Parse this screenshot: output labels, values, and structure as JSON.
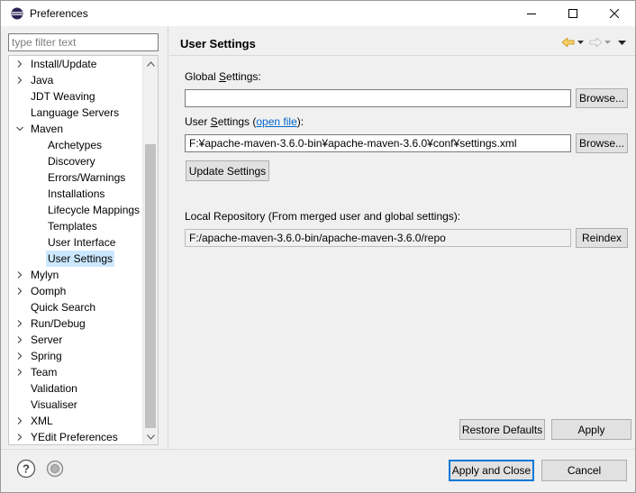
{
  "window": {
    "title": "Preferences",
    "minimize_icon": "minimize-icon",
    "maximize_icon": "maximize-icon",
    "close_icon": "close-icon"
  },
  "filter": {
    "placeholder": "type filter text",
    "value": ""
  },
  "tree": {
    "items": [
      {
        "label": "Install/Update",
        "level": 0,
        "twisty": "collapsed"
      },
      {
        "label": "Java",
        "level": 0,
        "twisty": "collapsed"
      },
      {
        "label": "JDT Weaving",
        "level": 0,
        "twisty": "none"
      },
      {
        "label": "Language Servers",
        "level": 0,
        "twisty": "none"
      },
      {
        "label": "Maven",
        "level": 0,
        "twisty": "expanded"
      },
      {
        "label": "Archetypes",
        "level": 1,
        "twisty": "none"
      },
      {
        "label": "Discovery",
        "level": 1,
        "twisty": "none"
      },
      {
        "label": "Errors/Warnings",
        "level": 1,
        "twisty": "none"
      },
      {
        "label": "Installations",
        "level": 1,
        "twisty": "none"
      },
      {
        "label": "Lifecycle Mappings",
        "level": 1,
        "twisty": "none"
      },
      {
        "label": "Templates",
        "level": 1,
        "twisty": "none"
      },
      {
        "label": "User Interface",
        "level": 1,
        "twisty": "none"
      },
      {
        "label": "User Settings",
        "level": 1,
        "twisty": "none",
        "selected": true
      },
      {
        "label": "Mylyn",
        "level": 0,
        "twisty": "collapsed"
      },
      {
        "label": "Oomph",
        "level": 0,
        "twisty": "collapsed"
      },
      {
        "label": "Quick Search",
        "level": 0,
        "twisty": "none"
      },
      {
        "label": "Run/Debug",
        "level": 0,
        "twisty": "collapsed"
      },
      {
        "label": "Server",
        "level": 0,
        "twisty": "collapsed"
      },
      {
        "label": "Spring",
        "level": 0,
        "twisty": "collapsed"
      },
      {
        "label": "Team",
        "level": 0,
        "twisty": "collapsed"
      },
      {
        "label": "Validation",
        "level": 0,
        "twisty": "none"
      },
      {
        "label": "Visualiser",
        "level": 0,
        "twisty": "none"
      },
      {
        "label": "XML",
        "level": 0,
        "twisty": "collapsed"
      },
      {
        "label": "YEdit Preferences",
        "level": 0,
        "twisty": "collapsed"
      }
    ]
  },
  "page": {
    "title": "User Settings",
    "global_settings_label_pre": "Global ",
    "global_settings_label_ul": "S",
    "global_settings_label_post": "ettings:",
    "global_settings_value": "",
    "browse_label": "Browse...",
    "user_settings_label_pre": "User ",
    "user_settings_label_ul": "S",
    "user_settings_label_mid": "ettings (",
    "open_file_link": "open file",
    "user_settings_label_post": "):",
    "user_settings_value": "F:¥apache-maven-3.6.0-bin¥apache-maven-3.6.0¥conf¥settings.xml",
    "update_settings_label": "Update Settings",
    "local_repo_label": "Local Repository (From merged user and global settings):",
    "local_repo_value": "F:/apache-maven-3.6.0-bin/apache-maven-3.6.0/repo",
    "reindex_label": "Reindex",
    "restore_defaults_label": "Restore Defaults",
    "apply_label": "Apply"
  },
  "footer": {
    "help_icon": "help-icon",
    "import_icon": "import-export-icon",
    "apply_close_label": "Apply and Close",
    "cancel_label": "Cancel"
  },
  "colors": {
    "selection": "#cce8ff",
    "link": "#0066cc",
    "default_button_border": "#0078d7",
    "nav_back_arrow": "#e8a317"
  }
}
